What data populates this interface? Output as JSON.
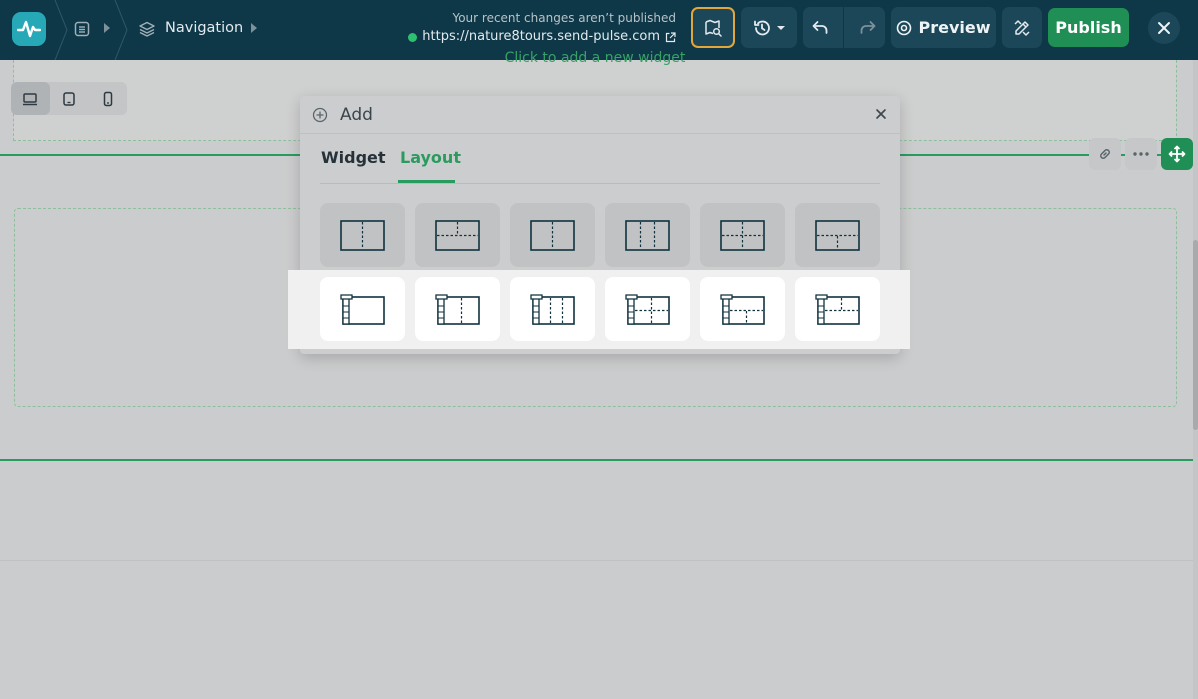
{
  "topbar": {
    "breadcrumb_label": "Navigation",
    "status_message": "Your recent changes aren’t published",
    "site_url": "https://nature8tours.send-pulse.com",
    "preview_label": "Preview",
    "publish_label": "Publish",
    "colors": {
      "bar": "#0e3747",
      "publish": "#1f8f55",
      "active_outline": "#e3a63b",
      "status_dot": "#2fbf71"
    }
  },
  "canvas": {
    "add_widget_hint": "Click to add a new widget",
    "devices": [
      "desktop-icon",
      "tablet-icon",
      "mobile-icon"
    ],
    "accent": "#2a9b5e"
  },
  "dialog": {
    "title": "Add",
    "tabs": [
      {
        "label": "Widget",
        "active": false
      },
      {
        "label": "Layout",
        "active": true
      }
    ],
    "layout_rows": [
      [
        "two-columns",
        "two-columns-top-split",
        "two-columns",
        "three-columns",
        "four-cells",
        "two-rows-bottom-split"
      ],
      [
        "sidebar-single",
        "sidebar-two-columns",
        "sidebar-three-columns",
        "sidebar-four-cells",
        "sidebar-rows-bottom-split",
        "sidebar-rows-top-split"
      ]
    ]
  }
}
